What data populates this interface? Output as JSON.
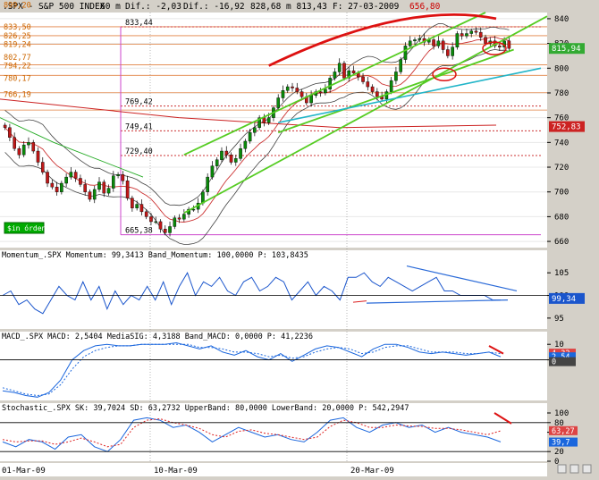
{
  "header": {
    "symbol": ".SPX - S&P 500 INDEX",
    "interval": "60 m",
    "dif": "Dif.: -2,03",
    "dif_pct": "Dif.: -16,92",
    "prices": "828,68 m 813,43",
    "date": "F: 27-03-2009",
    "last": "656,80"
  },
  "chart_data": [
    {
      "type": "line",
      "panel": "price",
      "ylim": [
        655,
        845
      ],
      "yticks": [
        "840",
        "820",
        "800",
        "780",
        "760",
        "740",
        "720",
        "700",
        "680",
        "660"
      ],
      "xlabels": [
        "01-Mar-09",
        "10-Mar-09",
        "20-Mar-09"
      ],
      "series": [
        {
          "name": "SPX",
          "values": [
            752,
            744,
            735,
            730,
            738,
            740,
            733,
            724,
            716,
            707,
            704,
            700,
            707,
            712,
            716,
            711,
            706,
            700,
            694,
            702,
            708,
            699,
            703,
            713,
            714,
            709,
            695,
            687,
            690,
            684,
            680,
            676,
            676,
            670,
            667,
            672,
            679,
            678,
            682,
            686,
            686,
            691,
            700,
            712,
            721,
            726,
            733,
            730,
            724,
            727,
            735,
            741,
            748,
            752,
            760,
            756,
            760,
            768,
            776,
            782,
            785,
            784,
            781,
            777,
            772,
            778,
            781,
            780,
            783,
            792,
            797,
            804,
            792,
            798,
            796,
            793,
            789,
            785,
            781,
            777,
            775,
            781,
            790,
            797,
            807,
            818,
            822,
            823,
            824,
            821,
            823,
            818,
            822,
            815,
            810,
            817,
            828,
            826,
            828,
            830,
            829,
            825,
            820,
            822,
            818,
            817,
            822,
            816
          ]
        }
      ],
      "price_levels": [
        "899,20",
        "833,50",
        "826,25",
        "819,24",
        "802,77",
        "794,22",
        "780,17",
        "766,19"
      ],
      "annotations": [
        "833,44",
        "769,42",
        "749,41",
        "729,40",
        "665,38",
        "815,94",
        "752,83"
      ],
      "button": "$in órdenes"
    },
    {
      "type": "line",
      "panel": "momentum",
      "label": "Momentum_.SPX Momentum: 99,3413 Band_Momentum: 100,0000 P: 103,8435",
      "yticks": [
        "105",
        "100",
        "95"
      ],
      "values_box": [
        "99,34"
      ],
      "series": [
        {
          "name": "Momentum",
          "values": [
            100,
            101,
            98,
            99,
            97,
            96,
            99,
            102,
            100,
            99,
            103,
            99,
            102,
            97,
            101,
            98,
            100,
            99,
            102,
            99,
            103,
            98,
            102,
            105,
            100,
            103,
            102,
            104,
            101,
            100,
            103,
            104,
            101,
            102,
            104,
            103,
            99,
            101,
            103,
            100,
            102,
            101,
            99,
            104,
            104,
            105,
            103,
            102,
            104,
            103,
            102,
            101,
            102,
            103,
            104,
            101,
            101,
            100,
            100,
            100,
            100,
            99,
            99
          ]
        }
      ]
    },
    {
      "type": "line",
      "panel": "macd",
      "label": "MACD_.SPX MACD: 2,5404 MediaSIG: 4,3188 Band_MACD: 0,0000 P: 41,2236",
      "yticks": [
        "10",
        "0"
      ],
      "values_box": [
        "4,32",
        "2,54",
        "0"
      ],
      "series": [
        {
          "name": "MACD",
          "values": [
            -20,
            -21,
            -23,
            -24,
            -21,
            -13,
            0,
            6,
            9,
            10,
            9,
            9,
            10,
            10,
            10,
            11,
            9,
            7,
            9,
            5,
            3,
            6,
            2,
            0,
            4,
            -1,
            3,
            7,
            9,
            8,
            5,
            2,
            7,
            10,
            10,
            8,
            5,
            4,
            5,
            4,
            3,
            4,
            5,
            2
          ]
        },
        {
          "name": "MediaSIG",
          "values": [
            -18,
            -20,
            -22,
            -23,
            -22,
            -16,
            -6,
            2,
            6,
            8,
            9,
            9,
            10,
            10,
            10,
            10,
            10,
            8,
            8,
            7,
            5,
            5,
            4,
            2,
            3,
            1,
            2,
            5,
            7,
            8,
            7,
            4,
            5,
            8,
            9,
            9,
            7,
            5,
            5,
            5,
            4,
            4,
            5,
            4
          ]
        }
      ]
    },
    {
      "type": "line",
      "panel": "stochastic",
      "label": "Stochastic_.SPX SK: 39,7024 SD: 63,2732 UpperBand: 80,0000 LowerBand: 20,0000 P: 542,2947",
      "yticks": [
        "100",
        "80",
        "60",
        "20",
        "0"
      ],
      "values_box": [
        "63,27",
        "39,7"
      ],
      "series": [
        {
          "name": "SK",
          "values": [
            40,
            30,
            45,
            40,
            25,
            50,
            55,
            30,
            20,
            45,
            85,
            90,
            85,
            70,
            75,
            60,
            40,
            55,
            70,
            60,
            50,
            55,
            45,
            40,
            60,
            85,
            90,
            70,
            60,
            75,
            80,
            70,
            75,
            60,
            70,
            60,
            55,
            50,
            40
          ]
        },
        {
          "name": "SD",
          "values": [
            45,
            40,
            42,
            42,
            35,
            40,
            48,
            40,
            30,
            35,
            70,
            85,
            88,
            80,
            75,
            68,
            55,
            50,
            62,
            65,
            58,
            55,
            50,
            45,
            50,
            72,
            85,
            80,
            70,
            70,
            75,
            73,
            72,
            68,
            68,
            65,
            60,
            55,
            63
          ]
        }
      ]
    }
  ]
}
